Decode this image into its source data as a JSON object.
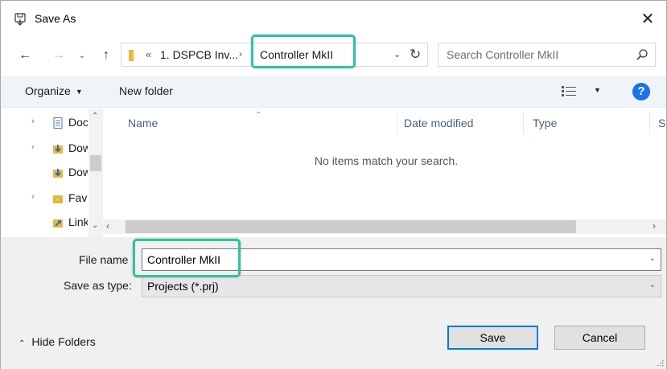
{
  "window": {
    "title": "Save As",
    "close_glyph": "✕"
  },
  "address": {
    "back_glyph": "←",
    "forward_glyph": "→",
    "recent_glyph": "⌄",
    "up_glyph": "↑",
    "overflow_glyph": "«",
    "crumb1": "1. DSPCB Inv...",
    "separator": "›",
    "crumb2": "Controller MkII",
    "dropdown_glyph": "⌄",
    "refresh_glyph": "↻"
  },
  "search": {
    "placeholder": "Search Controller MkII"
  },
  "toolbar": {
    "organize_label": "Organize",
    "organize_caret": "▼",
    "new_folder_label": "New folder",
    "view_caret": "▼",
    "help_glyph": "?"
  },
  "nav_pane": {
    "items": [
      {
        "label": "Documents",
        "expander": "›",
        "icon": "document-icon"
      },
      {
        "label": "Downloads",
        "expander": "›",
        "icon": "download-folder-icon"
      },
      {
        "label": "Downloads",
        "expander": "",
        "icon": "download-folder-icon"
      },
      {
        "label": "Favorites",
        "expander": "›",
        "icon": "favorites-folder-icon"
      },
      {
        "label": "Links",
        "expander": "",
        "icon": "links-folder-icon"
      }
    ],
    "scroll_up_glyph": "⌃",
    "scroll_down_glyph": "⌄"
  },
  "file_list": {
    "sort_glyph": "⌃",
    "columns": [
      "Name",
      "Date modified",
      "Type",
      "Size"
    ],
    "empty_message": "No items match your search.",
    "scroll_left_glyph": "‹",
    "scroll_right_glyph": "›"
  },
  "form": {
    "file_name_label": "File name",
    "file_name_value": "Controller MkII",
    "save_as_type_label": "Save as type:",
    "save_as_type_value": "Projects (*.prj)",
    "dropdown_glyph": "⌄"
  },
  "footer": {
    "hide_folders_caret": "⌃",
    "hide_folders_label": "Hide Folders",
    "save_label": "Save",
    "cancel_label": "Cancel"
  },
  "colors": {
    "highlight": "#2ec4a0",
    "help_blue": "#1a73e8",
    "folder_yellow": "#e8b93c",
    "default_button_border": "#0078d7"
  }
}
